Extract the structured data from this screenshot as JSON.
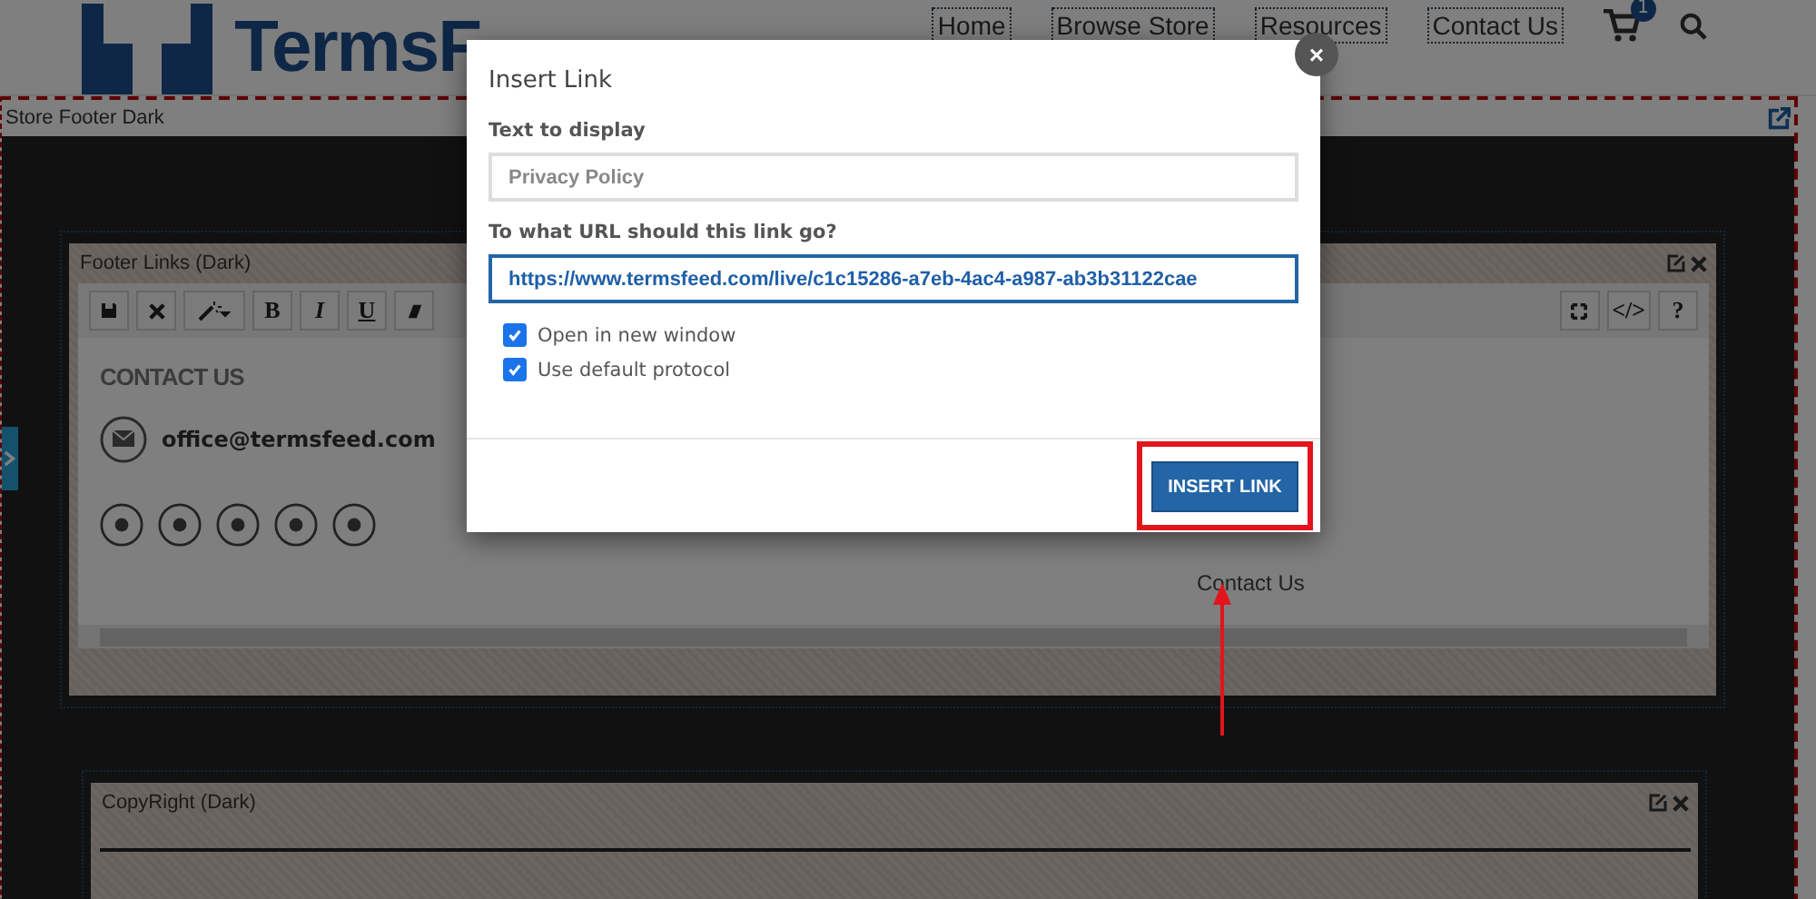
{
  "header": {
    "logo": "TermsF",
    "nav": [
      {
        "label": "Home"
      },
      {
        "label": "Browse Store"
      },
      {
        "label": "Resources"
      },
      {
        "label": "Contact Us"
      }
    ],
    "cart_count": "1"
  },
  "section": {
    "title": "Store Footer Dark"
  },
  "footer_links": {
    "title": "Footer Links (Dark)",
    "format_buttons": [
      "B",
      "I",
      "U"
    ],
    "end_buttons": [
      "</>",
      "?"
    ],
    "contact_heading": "CONTACT US",
    "email": "office@termsfeed.com",
    "link": "Contact Us"
  },
  "copyright": {
    "title": "CopyRight (Dark)"
  },
  "dialog": {
    "title": "Insert Link",
    "close": "×",
    "fields": [
      {
        "label": "Text to display",
        "placeholder": "Privacy Policy",
        "focused": false
      },
      {
        "label": "To what URL should this link go?",
        "value": "https://www.termsfeed.com/live/c1c15286-a7eb-4ac4-a987-ab3b31122cae",
        "focused": true
      }
    ],
    "checkboxes": [
      {
        "label": "Open in new window",
        "checked": true
      },
      {
        "label": "Use default protocol",
        "checked": true
      }
    ],
    "button": "INSERT LINK"
  }
}
